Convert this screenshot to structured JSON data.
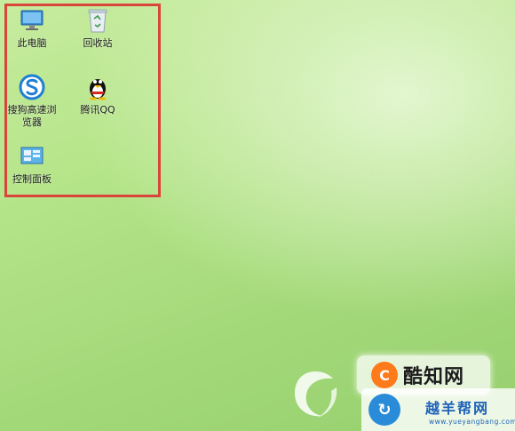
{
  "desktop": {
    "icons": [
      {
        "label": "此电脑",
        "icon": "computer-icon"
      },
      {
        "label": "回收站",
        "icon": "recycle-bin-icon"
      },
      {
        "label": "搜狗高速浏览器",
        "icon": "sogou-browser-icon"
      },
      {
        "label": "腾讯QQ",
        "icon": "qq-penguin-icon"
      },
      {
        "label": "控制面板",
        "icon": "control-panel-icon"
      }
    ]
  },
  "watermarks": {
    "kuzhi_text": "酷知网",
    "yueyangbang_title": "越羊帮网",
    "yueyangbang_url": "www.yueyangbang.com"
  },
  "colors": {
    "highlight_border": "#d9453a",
    "desktop_green": "#b4e488"
  }
}
